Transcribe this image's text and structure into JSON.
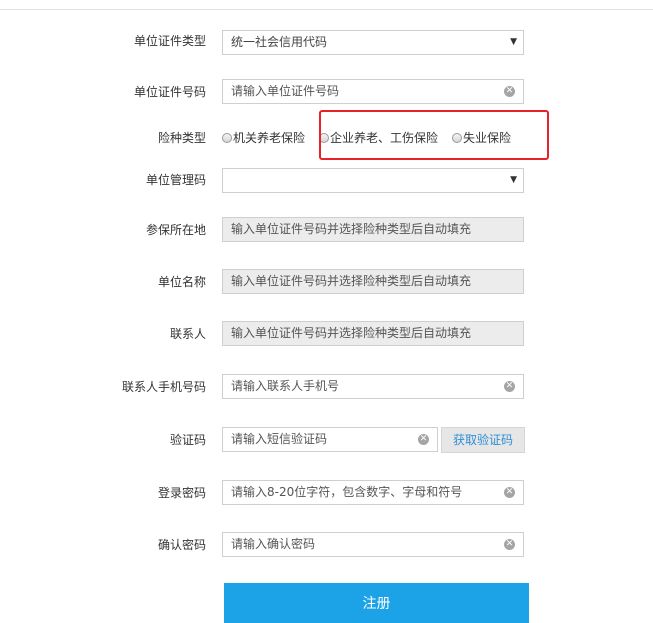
{
  "form": {
    "cert_type": {
      "label": "单位证件类型",
      "value": "统一社会信用代码"
    },
    "cert_no": {
      "label": "单位证件号码",
      "placeholder": "请输入单位证件号码"
    },
    "insurance_type": {
      "label": "险种类型",
      "options": [
        "机关养老保险",
        "企业养老、工伤保险",
        "失业保险"
      ]
    },
    "mgmt_code": {
      "label": "单位管理码",
      "value": ""
    },
    "location": {
      "label": "参保所在地",
      "placeholder": "输入单位证件号码并选择险种类型后自动填充"
    },
    "unit_name": {
      "label": "单位名称",
      "placeholder": "输入单位证件号码并选择险种类型后自动填充"
    },
    "contact": {
      "label": "联系人",
      "placeholder": "输入单位证件号码并选择险种类型后自动填充"
    },
    "contact_phone": {
      "label": "联系人手机号码",
      "placeholder": "请输入联系人手机号"
    },
    "sms_code": {
      "label": "验证码",
      "placeholder": "请输入短信验证码",
      "button": "获取验证码"
    },
    "password": {
      "label": "登录密码",
      "placeholder": "请输入8-20位字符，包含数字、字母和符号"
    },
    "confirm_password": {
      "label": "确认密码",
      "placeholder": "请输入确认密码"
    },
    "submit_label": "注册"
  },
  "icons": {
    "dropdown": "caret-down-icon",
    "clear": "clear-circle-icon"
  },
  "colors": {
    "highlight": "#e8212a",
    "primary": "#1ca2e6",
    "link": "#2d8fd6"
  }
}
